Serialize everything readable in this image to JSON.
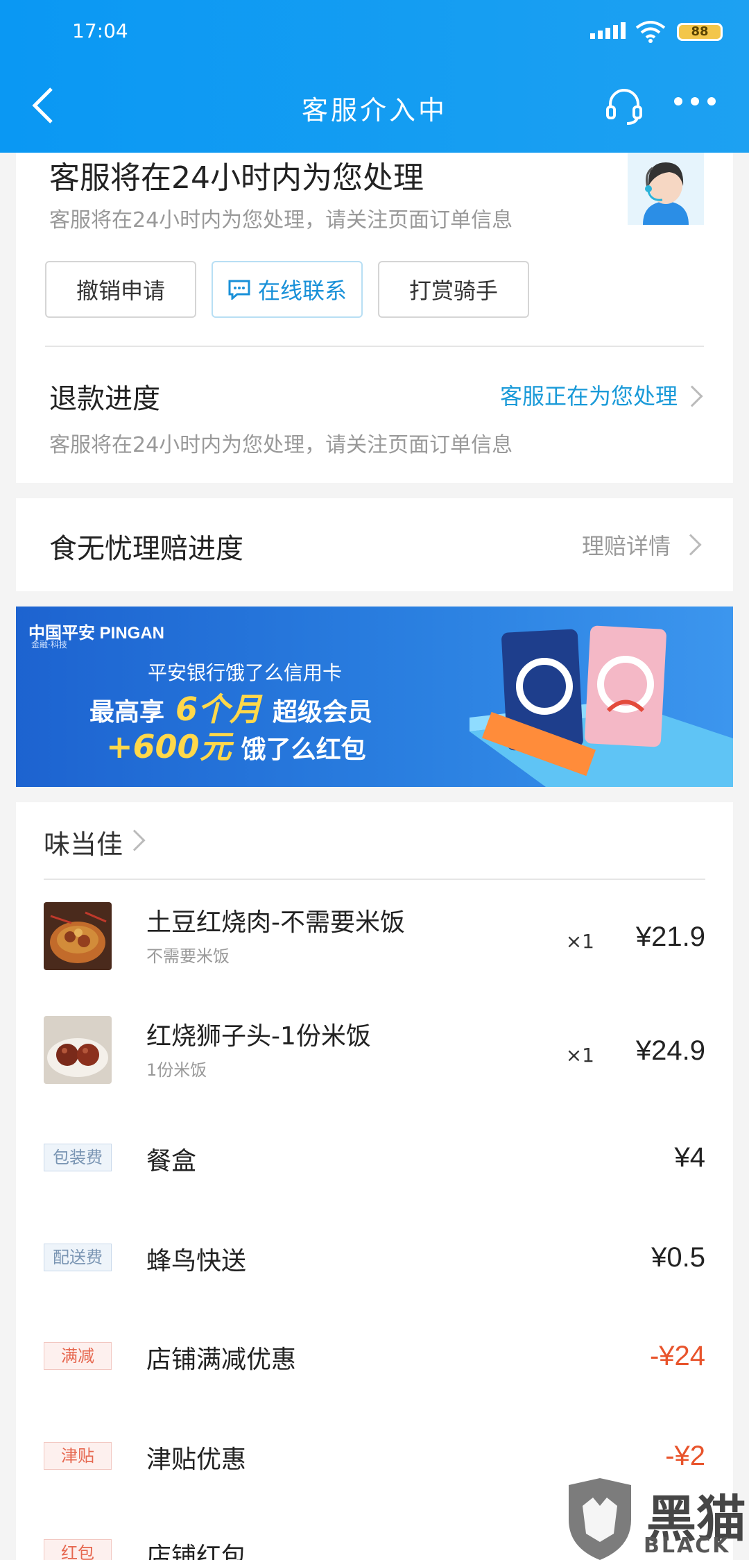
{
  "status_bar": {
    "time": "17:04",
    "battery": "88"
  },
  "header": {
    "title": "客服介入中"
  },
  "service_card": {
    "title": "客服将在24小时内为您处理",
    "subtitle": "客服将在24小时内为您处理，请关注页面订单信息",
    "buttons": {
      "cancel": "撤销申请",
      "contact": "在线联系",
      "tip": "打赏骑手"
    },
    "refund_label": "退款进度",
    "refund_status": "客服正在为您处理",
    "refund_subtitle": "客服将在24小时内为您处理，请关注页面订单信息"
  },
  "claim_card": {
    "label": "食无忧理赔进度",
    "link": "理赔详情"
  },
  "banner": {
    "brand": "中国平安 PINGAN",
    "brand_sub": "金融·科技",
    "headline": "平安银行饿了么信用卡",
    "line1_pre": "最高享",
    "line1_highlight": "6个月",
    "line1_post": "超级会员",
    "line2_highlight": "+600元",
    "line2_post": "饿了么红包"
  },
  "order": {
    "shop": "味当佳",
    "items": [
      {
        "name": "土豆红烧肉-不需要米饭",
        "spec": "不需要米饭",
        "qty": "×1",
        "price": "¥21.9"
      },
      {
        "name": "红烧狮子头-1份米饭",
        "spec": "1份米饭",
        "qty": "×1",
        "price": "¥24.9"
      }
    ],
    "fees": [
      {
        "tag": "包装费",
        "name": "餐盒",
        "amount": "¥4"
      },
      {
        "tag": "配送费",
        "name": "蜂鸟快送",
        "amount": "¥0.5"
      },
      {
        "tag": "满减",
        "name": "店铺满减优惠",
        "amount": "-¥24"
      },
      {
        "tag": "津贴",
        "name": "津贴优惠",
        "amount": "-¥2"
      },
      {
        "tag": "红包",
        "name": "店铺红包",
        "amount": ""
      }
    ]
  },
  "watermark": {
    "cn": "黑猫",
    "en": "BLACK CAT"
  },
  "colors": {
    "header_blue": "#1a9cf2",
    "link_blue": "#1a9ad8",
    "discount_red": "#e8542c",
    "banner_yellow": "#ffd84a"
  }
}
